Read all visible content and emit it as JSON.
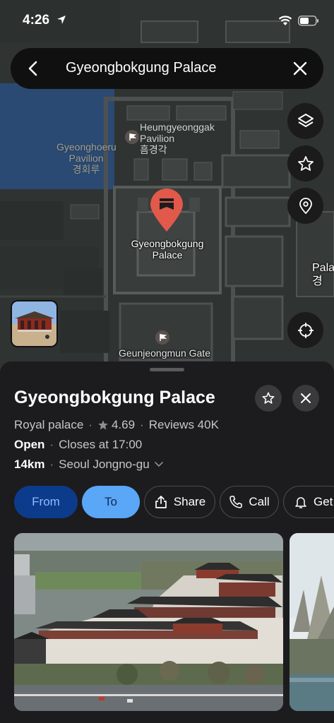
{
  "status": {
    "time": "4:26"
  },
  "search": {
    "query": "Gyeongbokgung Palace"
  },
  "map": {
    "labels": {
      "gyeonghoeru_en": "Gyeonghoeru",
      "gyeonghoeru_en2": "Pavilion",
      "gyeonghoeru_kr": "경회루",
      "heumgyeong_en": "Heumgyeonggak",
      "heumgyeong_en2": "Pavilion",
      "heumgyeong_kr": "흠경각",
      "palace_en": "Gyeongbokgung",
      "palace_en2": "Palace",
      "geunjeong_en": "Geunjeongmun Gate",
      "edge_en": "Pala",
      "edge_kr": "경"
    }
  },
  "sheet": {
    "title": "Gyeongbokgung Palace",
    "category": "Royal palace",
    "rating": "4.69",
    "reviews": "Reviews 40K",
    "open_status": "Open",
    "closes": "Closes at 17:00",
    "distance": "14km",
    "district": "Seoul Jongno-gu",
    "actions": {
      "from": "From",
      "to": "To",
      "share": "Share",
      "call": "Call",
      "get": "Get"
    }
  },
  "colors": {
    "accent_blue": "#5aa6f7",
    "from_blue": "#0d3b8c",
    "pin_red": "#e0594b",
    "sheet_bg": "#1c1c1e"
  }
}
